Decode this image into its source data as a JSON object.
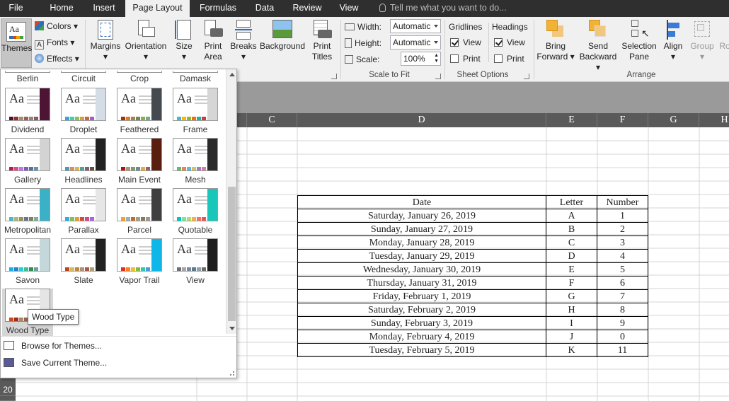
{
  "tabs": [
    {
      "label": "File"
    },
    {
      "label": "Home"
    },
    {
      "label": "Insert"
    },
    {
      "label": "Page Layout"
    },
    {
      "label": "Formulas"
    },
    {
      "label": "Data"
    },
    {
      "label": "Review"
    },
    {
      "label": "View"
    }
  ],
  "tell_me": "Tell me what you want to do...",
  "ribbon": {
    "themes": {
      "label": "Themes",
      "colors": "Colors",
      "fonts": "Fonts",
      "effects": "Effects"
    },
    "page_setup": {
      "margins": "Margins",
      "orientation": "Orientation",
      "size": "Size",
      "print_area_1": "Print",
      "print_area_2": "Area",
      "breaks": "Breaks",
      "background": "Background",
      "print_titles_1": "Print",
      "print_titles_2": "Titles"
    },
    "scale_to_fit": {
      "width_label": "Width:",
      "width_value": "Automatic",
      "height_label": "Height:",
      "height_value": "Automatic",
      "scale_label": "Scale:",
      "scale_value": "100%",
      "group_label": "Scale to Fit"
    },
    "sheet_options": {
      "gridlines": "Gridlines",
      "headings": "Headings",
      "view": "View",
      "print": "Print",
      "group_label": "Sheet Options"
    },
    "arrange": {
      "bring_1": "Bring",
      "bring_2": "Forward",
      "send_1": "Send",
      "send_2": "Backward",
      "selection_1": "Selection",
      "selection_2": "Pane",
      "align": "Align",
      "group": "Group",
      "rotate": "Ro",
      "group_label": "Arrange"
    }
  },
  "theme_gallery": {
    "top_row": [
      "Berlin",
      "Circuit",
      "Crop",
      "Damask"
    ],
    "themes": [
      {
        "name": "Dividend",
        "accent": "#4d1434",
        "colors": [
          "#4d1434",
          "#9b2d1f",
          "#a28e6a",
          "#956251",
          "#918485",
          "#855d5d"
        ]
      },
      {
        "name": "Droplet",
        "accent": "#d4dce6",
        "colors": [
          "#2fa3ee",
          "#4bcaad",
          "#86c157",
          "#d99c3f",
          "#ce6633",
          "#a35dd1"
        ]
      },
      {
        "name": "Feathered",
        "accent": "#444a50",
        "colors": [
          "#a53010",
          "#de7e18",
          "#9f8351",
          "#728653",
          "#92aa4c",
          "#6aac91"
        ]
      },
      {
        "name": "Frame",
        "accent": "#d6d6d6",
        "colors": [
          "#40bad2",
          "#fab900",
          "#90bb23",
          "#ee7008",
          "#1ab39f",
          "#d5393d"
        ]
      },
      {
        "name": "Gallery",
        "accent": "#d3d3d3",
        "colors": [
          "#b71e42",
          "#de478e",
          "#bc72f0",
          "#795faf",
          "#586ea6",
          "#6892a0"
        ]
      },
      {
        "name": "Headlines",
        "accent": "#222222",
        "colors": [
          "#439eb7",
          "#e28b55",
          "#dcb64d",
          "#4ca198",
          "#835b82",
          "#645135"
        ]
      },
      {
        "name": "Main Event",
        "accent": "#5a1e0f",
        "colors": [
          "#b80e0f",
          "#a6987d",
          "#7f9a71",
          "#64908a",
          "#e8a936",
          "#8d6374"
        ]
      },
      {
        "name": "Mesh",
        "accent": "#2a2a2a",
        "colors": [
          "#6bb76d",
          "#e88651",
          "#5eb6e4",
          "#d3c25e",
          "#9d7fc1",
          "#dd7b9c"
        ]
      },
      {
        "name": "Metropolitan",
        "accent": "#3bb1c8",
        "colors": [
          "#50b4c8",
          "#a8b97f",
          "#9b9256",
          "#657689",
          "#7a855d",
          "#84ac9d"
        ]
      },
      {
        "name": "Parallax",
        "accent": "#e6e6e6",
        "colors": [
          "#30acec",
          "#80c34f",
          "#e29d3e",
          "#d64a3b",
          "#d64787",
          "#a666e1"
        ]
      },
      {
        "name": "Parcel",
        "accent": "#3f3f3f",
        "colors": [
          "#f6a21d",
          "#9bafb5",
          "#c96731",
          "#9ca383",
          "#87795d",
          "#a0988c"
        ]
      },
      {
        "name": "Quotable",
        "accent": "#18c6ba",
        "colors": [
          "#00c6bb",
          "#6feba0",
          "#b6df5e",
          "#efb251",
          "#ef755f",
          "#ed515c"
        ]
      },
      {
        "name": "Savon",
        "accent": "#c4d8dc",
        "colors": [
          "#1cade4",
          "#2683c6",
          "#27ced7",
          "#42ba97",
          "#3e8853",
          "#62a39f"
        ]
      },
      {
        "name": "Slate",
        "accent": "#222222",
        "colors": [
          "#bc451b",
          "#d3ba68",
          "#bb8640",
          "#ad9277",
          "#a55a43",
          "#ad9d7b"
        ]
      },
      {
        "name": "Vapor Trail",
        "accent": "#0fb7e8",
        "colors": [
          "#df2e28",
          "#fe801a",
          "#e9bf35",
          "#81bb42",
          "#32c7a9",
          "#4a9bdc"
        ]
      },
      {
        "name": "View",
        "accent": "#1e1e1e",
        "colors": [
          "#6f6f74",
          "#a4a4a8",
          "#7b8a9b",
          "#5d7a8a",
          "#91a1a6",
          "#6d6d6d"
        ]
      },
      {
        "name": "Wood Type",
        "accent": "#e5e5e5",
        "colors": [
          "#d34817",
          "#9b2d1f",
          "#a28e6a",
          "#956251",
          "#918485",
          "#855d5d"
        ]
      }
    ],
    "browse": "Browse for Themes...",
    "save": "Save Current Theme...",
    "tooltip": "Wood Type"
  },
  "sheet": {
    "columns": [
      "C",
      "D",
      "E",
      "F",
      "G",
      "H"
    ],
    "row_numbers": [
      "20"
    ],
    "table": {
      "headers": [
        "Date",
        "Letter",
        "Number"
      ],
      "rows": [
        [
          "Saturday, January 26, 2019",
          "A",
          "1"
        ],
        [
          "Sunday, January 27, 2019",
          "B",
          "2"
        ],
        [
          "Monday, January 28, 2019",
          "C",
          "3"
        ],
        [
          "Tuesday, January 29, 2019",
          "D",
          "4"
        ],
        [
          "Wednesday, January 30, 2019",
          "E",
          "5"
        ],
        [
          "Thursday, January 31, 2019",
          "F",
          "6"
        ],
        [
          "Friday, February 1, 2019",
          "G",
          "7"
        ],
        [
          "Saturday, February 2, 2019",
          "H",
          "8"
        ],
        [
          "Sunday, February 3, 2019",
          "I",
          "9"
        ],
        [
          "Monday, February 4, 2019",
          "J",
          "0"
        ],
        [
          "Tuesday, February 5, 2019",
          "K",
          "11"
        ]
      ]
    }
  },
  "colors": {
    "tabbar": "#2f2f2f",
    "ribbon": "#f0f0f0",
    "header": "#5a5a5a"
  }
}
